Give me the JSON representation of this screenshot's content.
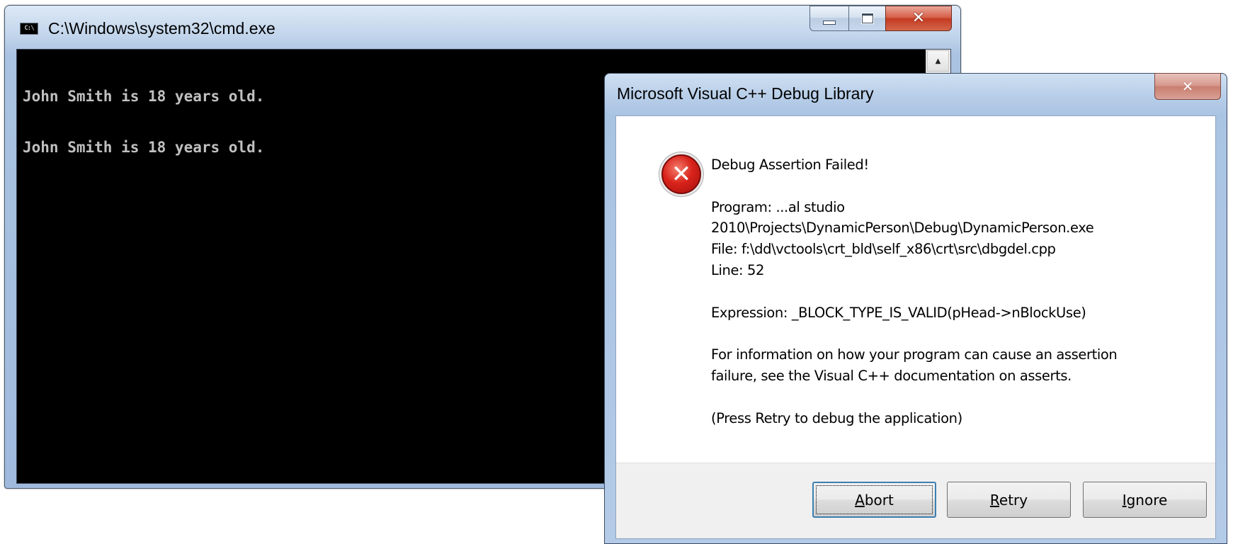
{
  "cmd": {
    "title": "C:\\Windows\\system32\\cmd.exe",
    "icon_text": "C:\\",
    "console_lines": [
      "John Smith is 18 years old.",
      "John Smith is 18 years old."
    ]
  },
  "dialog": {
    "title": "Microsoft Visual C++ Debug Library",
    "message_lines": [
      "Debug Assertion Failed!",
      "",
      "Program: ...al studio",
      "2010\\Projects\\DynamicPerson\\Debug\\DynamicPerson.exe",
      "File: f:\\dd\\vctools\\crt_bld\\self_x86\\crt\\src\\dbgdel.cpp",
      "Line: 52",
      "",
      "Expression: _BLOCK_TYPE_IS_VALID(pHead->nBlockUse)",
      "",
      "For information on how your program can cause an assertion",
      "failure, see the Visual C++ documentation on asserts.",
      "",
      "(Press Retry to debug the application)"
    ],
    "buttons": {
      "abort": "Abort",
      "retry": "Retry",
      "ignore": "Ignore"
    },
    "error_icon_glyph": "✕"
  },
  "icons": {
    "error": "error-icon",
    "close": "close-icon",
    "minimize": "minimize-icon",
    "maximize": "maximize-icon",
    "scroll_up": "scroll-up-arrow-icon",
    "app": "cmd-app-icon"
  },
  "colors": {
    "console_bg": "#000000",
    "console_text": "#c0c0c0",
    "close_button": "#c43b22",
    "error_red": "#d9231b"
  }
}
